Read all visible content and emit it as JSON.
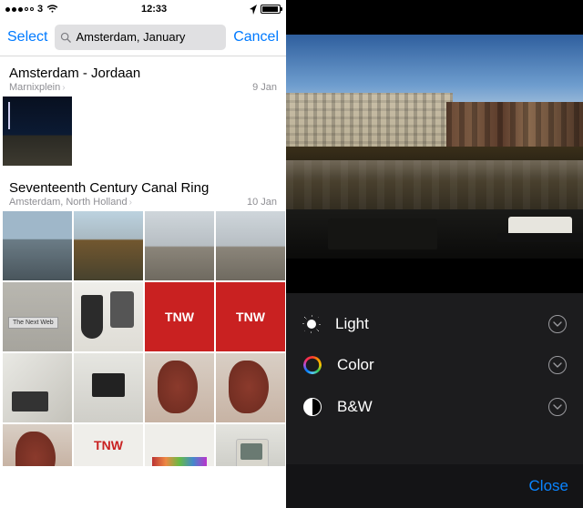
{
  "statusbar": {
    "carrier": "3",
    "time": "12:33"
  },
  "navbar": {
    "select_label": "Select",
    "cancel_label": "Cancel"
  },
  "search": {
    "value": "Amsterdam, January"
  },
  "sections": [
    {
      "title": "Amsterdam - Jordaan",
      "subtitle": "Marnixplein",
      "date": "9 Jan"
    },
    {
      "title": "Seventeenth Century Canal Ring",
      "subtitle": "Amsterdam, North Holland",
      "date": "10 Jan"
    }
  ],
  "editor": {
    "controls": [
      {
        "label": "Light"
      },
      {
        "label": "Color"
      },
      {
        "label": "B&W"
      }
    ],
    "close_label": "Close"
  },
  "colors": {
    "ios_blue": "#007aff",
    "ios_blue_dark": "#0a84ff"
  }
}
